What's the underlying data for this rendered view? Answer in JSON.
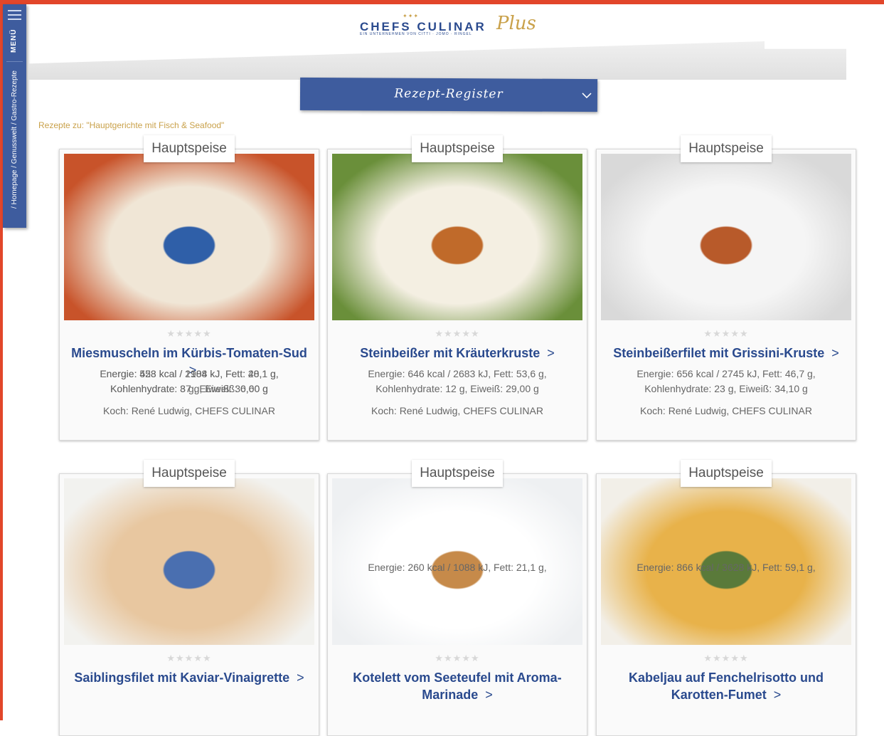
{
  "header": {
    "logo_main": "CHEFS CULINAR",
    "logo_sub": "EIN UNTERNEHMEN VON CITTI · JOMO · RINGEL",
    "logo_plus": "Plus"
  },
  "sidebar": {
    "menu_label": "MENÜ",
    "breadcrumb": "/ Homepage / Genusswelt / Gastro-Rezepte"
  },
  "register": {
    "label": "Rezept-Register"
  },
  "results_label": "Rezepte zu: \"Hauptgerichte mit Fisch & Seafood\"",
  "colors": {
    "accent": "#3e5c9e",
    "title": "#2a4a8e",
    "gold": "#c9a14a",
    "brand_bar": "#e2462a"
  },
  "recipes": [
    {
      "tag": "Hauptspeise",
      "rating": 5,
      "title": "Miesmuscheln im Kürbis-Tomaten-Sud",
      "nutri_1": "Energie: 458 kcal / 1908 kJ, Fett: 28,1 g,",
      "nutri_2": "Kohlenhydrate: 37 g, Eiweiß: 6,00 g",
      "chef": "Koch: René Ludwig, CHEFS CULINAR"
    },
    {
      "tag": "Hauptspeise",
      "rating": 5,
      "title": "Steinbeißer mit Kräuterkruste",
      "nutri_1": "Energie: 646 kcal / 2683 kJ, Fett: 53,6 g,",
      "nutri_2": "Kohlenhydrate: 12 g, Eiweiß: 29,00 g",
      "chef": "Koch: René Ludwig, CHEFS CULINAR"
    },
    {
      "tag": "Hauptspeise",
      "rating": 5,
      "title": "Steinbeißerfilet mit Grissini-Kruste",
      "nutri_1": "Energie: 656 kcal / 2745 kJ, Fett: 46,7 g,",
      "nutri_2": "Kohlenhydrate: 23 g, Eiweiß: 34,10 g",
      "chef": "Koch: René Ludwig, CHEFS CULINAR"
    },
    {
      "tag": "Hauptspeise",
      "rating": 5,
      "title": "Saiblingsfilet mit Kaviar-Vinaigrette",
      "nutri_1": "Energie: 523 kcal / 2184 kJ, Fett: 40,1 g,",
      "nutri_2": "Kohlenhydrate: 8 g, Eiweiß: 30,60 g"
    },
    {
      "tag": "Hauptspeise",
      "rating": 5,
      "title": "Kotelett vom Seeteufel mit Aroma-Marinade",
      "nutri_1": "Energie: 260 kcal / 1088 kJ, Fett: 21,1 g,"
    },
    {
      "tag": "Hauptspeise",
      "rating": 5,
      "title": "Kabeljau auf Fenchelrisotto und Karotten-Fumet",
      "nutri_1": "Energie: 866 kcal / 3628 kJ, Fett: 59,1 g,"
    }
  ]
}
